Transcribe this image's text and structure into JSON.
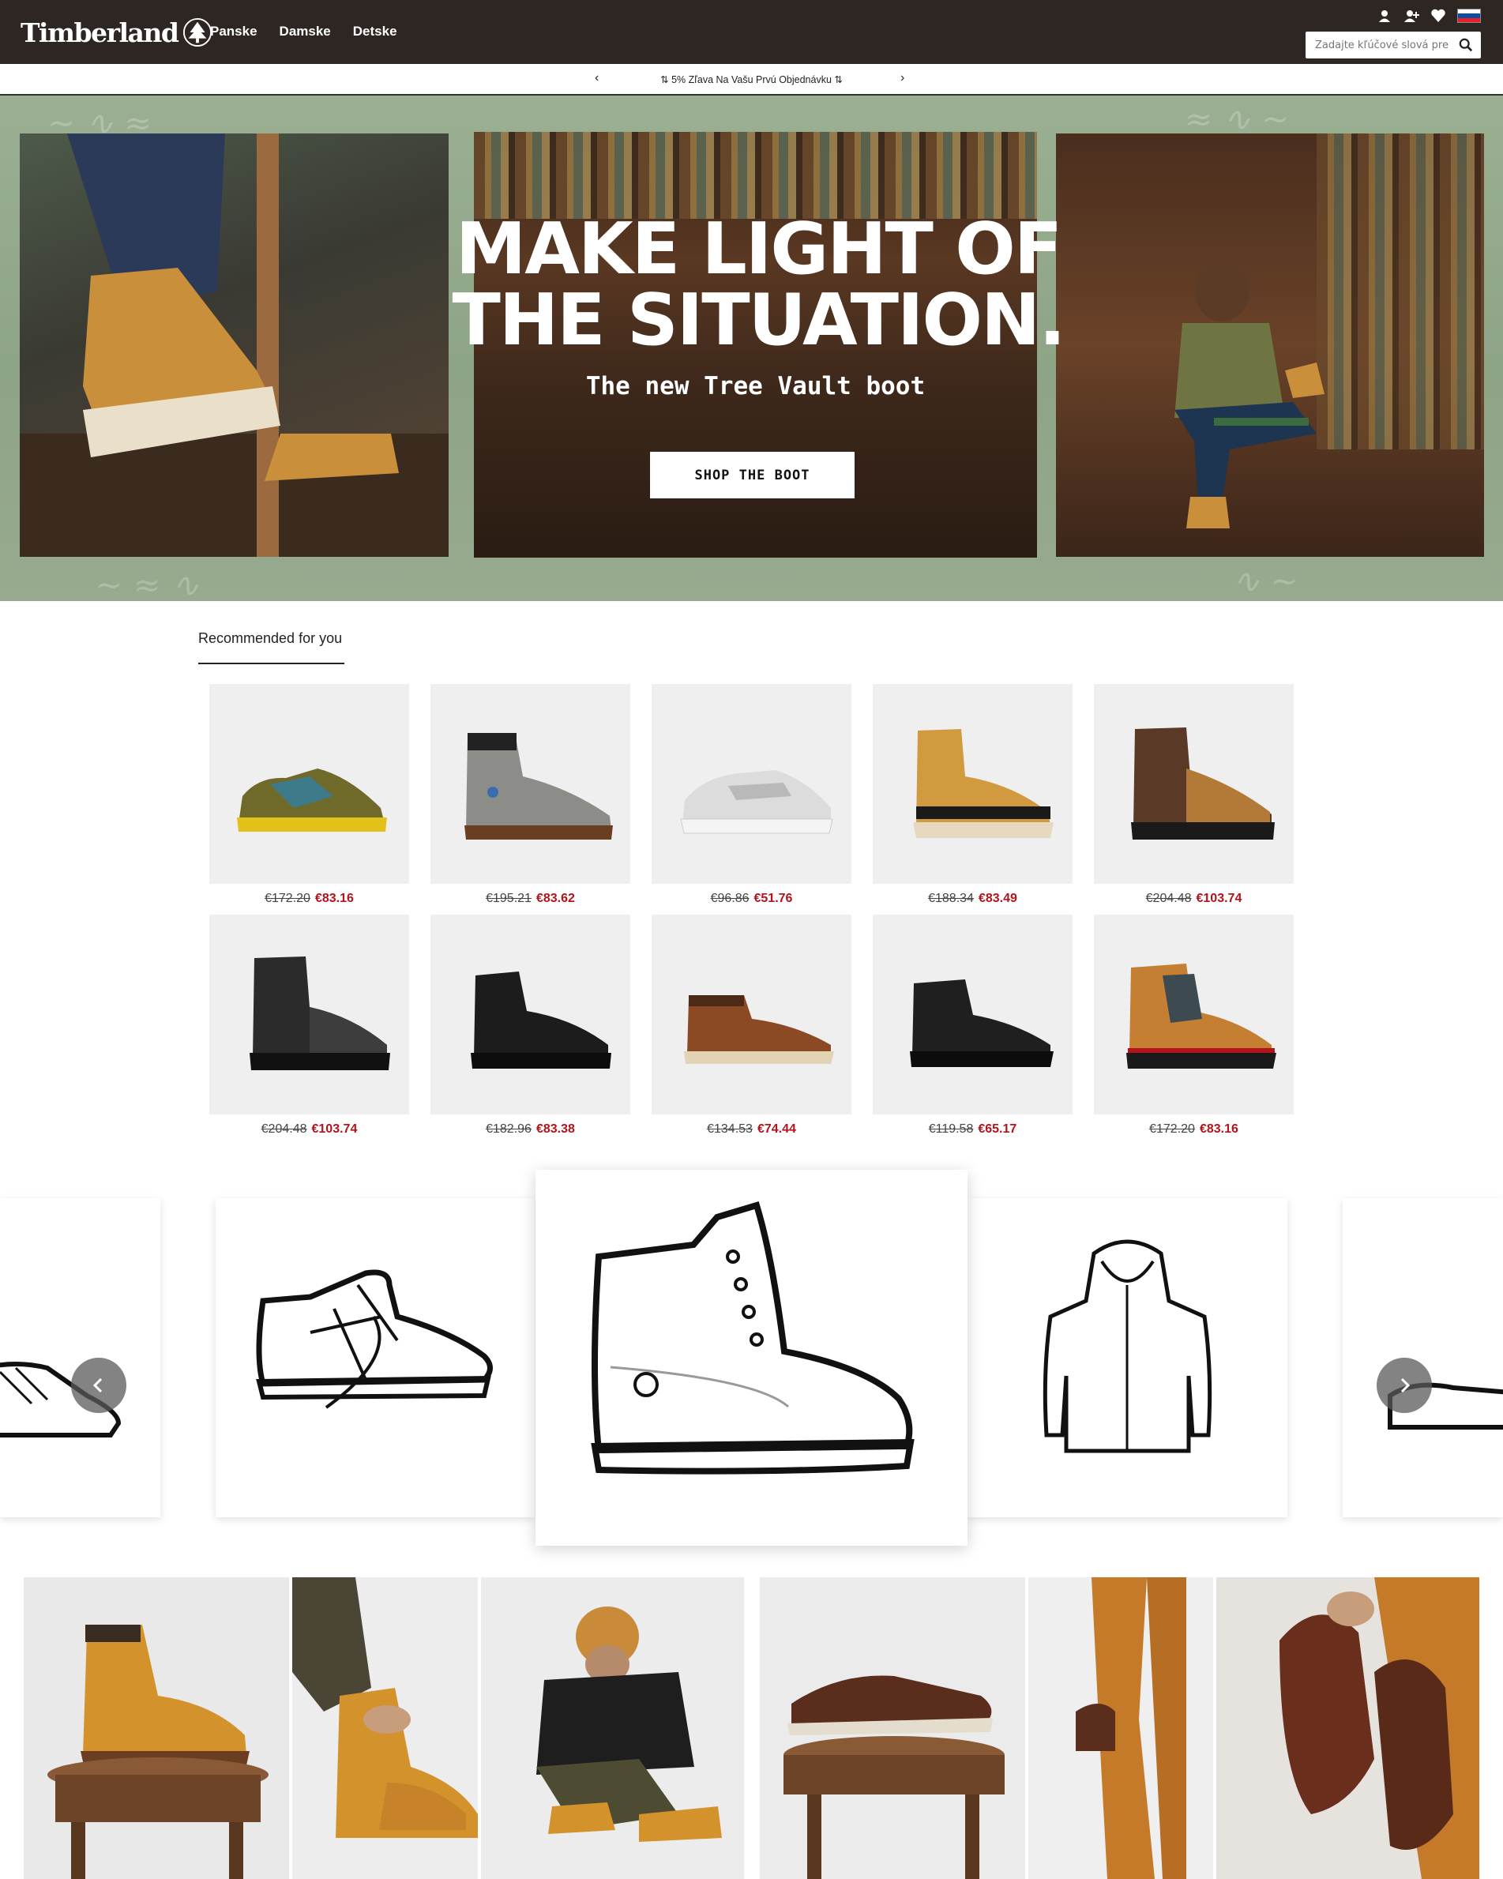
{
  "header": {
    "logo": "Timberland",
    "nav": [
      "Panske",
      "Damske",
      "Detske"
    ],
    "search_placeholder": "Zadajte kľúčové slová pre",
    "flag_colors": [
      "#ffffff",
      "#0b4ea2",
      "#ee1c25"
    ]
  },
  "promo": {
    "text": "⇅ 5% Zľava Na Vašu Prvú Objednávku ⇅",
    "prev": "‹",
    "next": "›"
  },
  "hero": {
    "title_line1": "MAKE LIGHT OF",
    "title_line2": "THE SITUATION.",
    "subtitle": "The new Tree Vault boot",
    "cta": "SHOP THE BOOT"
  },
  "recommended": {
    "title": "Recommended for you",
    "products": [
      {
        "old": "€172.20",
        "new": "€83.16",
        "icon": "sneaker-camo-icon"
      },
      {
        "old": "€195.21",
        "new": "€83.62",
        "icon": "grey-boot-icon"
      },
      {
        "old": "€96.86",
        "new": "€51.76",
        "icon": "white-sneaker-icon"
      },
      {
        "old": "€188.34",
        "new": "€83.49",
        "icon": "wheat-boot-icon"
      },
      {
        "old": "€204.48",
        "new": "€103.74",
        "icon": "brown-hiker-icon"
      },
      {
        "old": "€204.48",
        "new": "€103.74",
        "icon": "black-hiker-icon"
      },
      {
        "old": "€182.96",
        "new": "€83.38",
        "icon": "black-boot-icon"
      },
      {
        "old": "€134.53",
        "new": "€74.44",
        "icon": "brown-chukka-icon"
      },
      {
        "old": "€119.58",
        "new": "€65.17",
        "icon": "black-chukka-icon"
      },
      {
        "old": "€172.20",
        "new": "€83.16",
        "icon": "euro-hiker-icon"
      }
    ]
  },
  "colors": {
    "header_bg": "#2d2622",
    "sale_red": "#b5121b",
    "hero_green": "#9bb093"
  }
}
